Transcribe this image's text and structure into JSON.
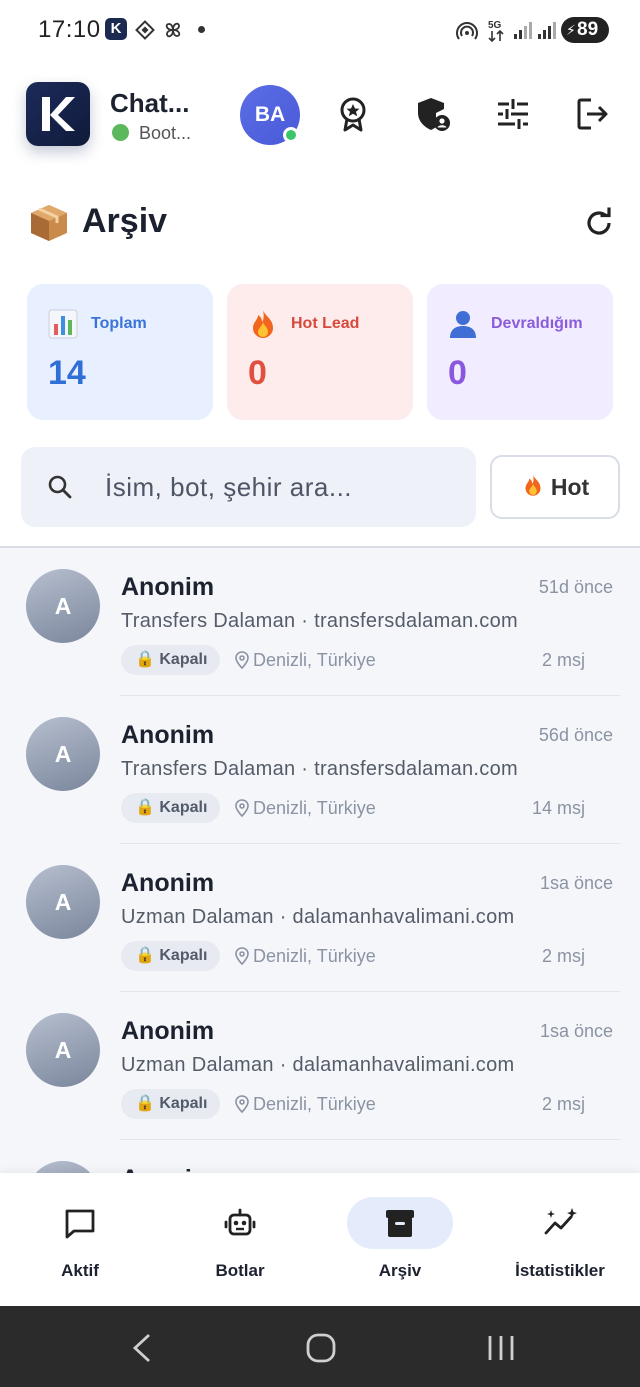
{
  "status_bar": {
    "time": "17:10",
    "battery": "89",
    "network": "5G",
    "app_badge": "K"
  },
  "header": {
    "app_name": "Chat...",
    "bot_status": "Boot...",
    "user_initials": "BA",
    "status_color": "#5cb85c"
  },
  "page": {
    "emoji": "📦",
    "title": "Arşiv"
  },
  "stats": [
    {
      "label": "Toplam",
      "value": "14",
      "icon": "bar-chart-icon"
    },
    {
      "label": "Hot Lead",
      "value": "0",
      "icon": "fire-icon"
    },
    {
      "label": "Devraldığım",
      "value": "0",
      "icon": "user-icon"
    }
  ],
  "search": {
    "placeholder": "İsim, bot, şehir ara...",
    "value": ""
  },
  "filter": {
    "hot_label": "Hot"
  },
  "conversations": [
    {
      "initial": "A",
      "name": "Anonim",
      "time": "51d önce",
      "subtitle": "Transfers Dalaman · transfersdalaman.com",
      "status": "Kapalı",
      "location": "Denizli, Türkiye",
      "messages": "2 msj"
    },
    {
      "initial": "A",
      "name": "Anonim",
      "time": "56d önce",
      "subtitle": "Transfers Dalaman · transfersdalaman.com",
      "status": "Kapalı",
      "location": "Denizli, Türkiye",
      "messages": "14 msj"
    },
    {
      "initial": "A",
      "name": "Anonim",
      "time": "1sa önce",
      "subtitle": "Uzman Dalaman · dalamanhavalimani.com",
      "status": "Kapalı",
      "location": "Denizli, Türkiye",
      "messages": "2 msj"
    },
    {
      "initial": "A",
      "name": "Anonim",
      "time": "1sa önce",
      "subtitle": "Uzman Dalaman · dalamanhavalimani.com",
      "status": "Kapalı",
      "location": "Denizli, Türkiye",
      "messages": "2 msj"
    },
    {
      "initial": "A",
      "name": "Anonim"
    }
  ],
  "bottom_nav": [
    {
      "label": "Aktif",
      "icon": "chat-bubble-icon",
      "active": false
    },
    {
      "label": "Botlar",
      "icon": "robot-icon",
      "active": false
    },
    {
      "label": "Arşiv",
      "icon": "archive-box-icon",
      "active": true
    },
    {
      "label": "İstatistikler",
      "icon": "stats-sparkle-icon",
      "active": false
    }
  ],
  "colors": {
    "accent": "#4a5ad8",
    "active_nav_bg": "#e4ebfb",
    "hot": "#e0503e",
    "total": "#2f6fd6",
    "mine": "#8957e0"
  }
}
